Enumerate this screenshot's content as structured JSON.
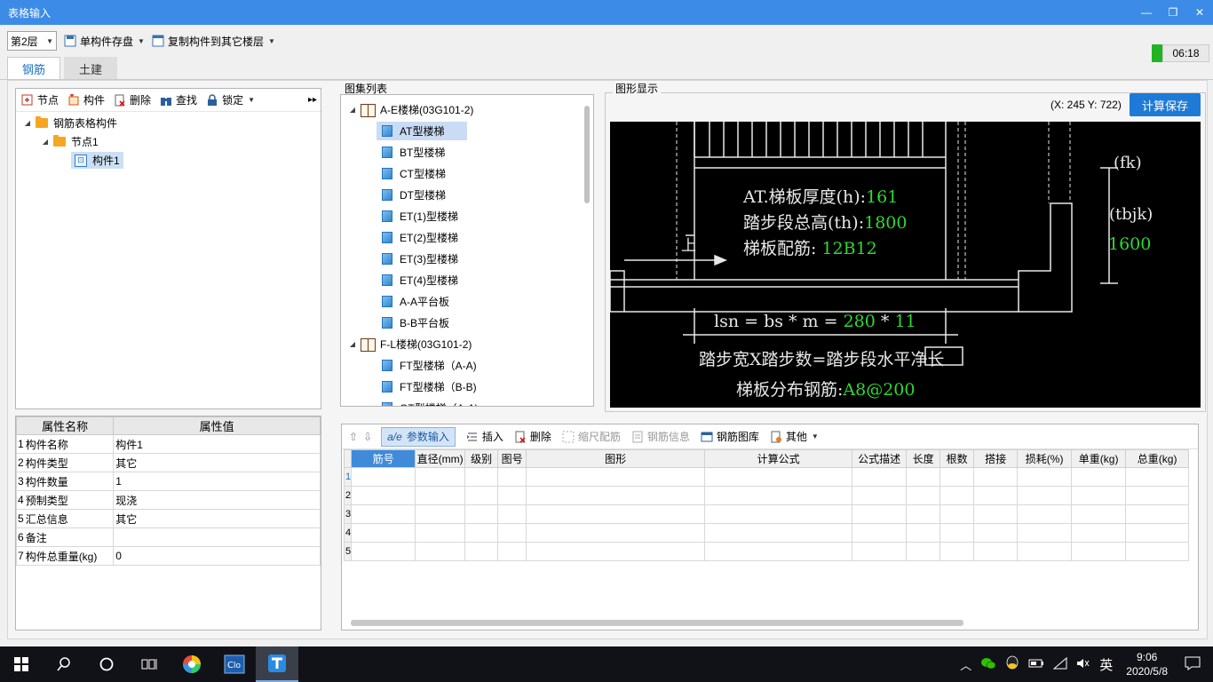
{
  "window": {
    "title": "表格输入",
    "min": "—",
    "restore": "❐",
    "close": "✕"
  },
  "toolbar": {
    "floor": "第2层",
    "save_single": "单构件存盘",
    "copy_to_floor": "复制构件到其它楼层"
  },
  "timer": "06:18",
  "tabs": [
    {
      "label": "钢筋"
    },
    {
      "label": "土建"
    }
  ],
  "left_toolbar": {
    "node": "节点",
    "component": "构件",
    "delete": "删除",
    "find": "查找",
    "lock": "锁定"
  },
  "tree": {
    "root": "钢筋表格构件",
    "node": "节点1",
    "component": "构件1"
  },
  "properties": {
    "header_name": "属性名称",
    "header_value": "属性值",
    "rows": [
      {
        "idx": "1",
        "name": "构件名称",
        "value": "构件1"
      },
      {
        "idx": "2",
        "name": "构件类型",
        "value": "其它"
      },
      {
        "idx": "3",
        "name": "构件数量",
        "value": "1"
      },
      {
        "idx": "4",
        "name": "预制类型",
        "value": "现浇"
      },
      {
        "idx": "5",
        "name": "汇总信息",
        "value": "其它"
      },
      {
        "idx": "6",
        "name": "备注",
        "value": ""
      },
      {
        "idx": "7",
        "name": "构件总重量(kg)",
        "value": "0"
      }
    ]
  },
  "atlas": {
    "title": "图集列表",
    "group1": "A-E楼梯(03G101-2)",
    "group1_items": [
      "AT型楼梯",
      "BT型楼梯",
      "CT型楼梯",
      "DT型楼梯",
      "ET(1)型楼梯",
      "ET(2)型楼梯",
      "ET(3)型楼梯",
      "ET(4)型楼梯",
      "A-A平台板",
      "B-B平台板"
    ],
    "group2": "F-L楼梯(03G101-2)",
    "group2_items": [
      "FT型楼梯（A-A)",
      "FT型楼梯（B-B)",
      "GT型楼梯（A-A)"
    ]
  },
  "graphic": {
    "title": "图形显示",
    "coords": "(X: 245 Y: 722)",
    "calc_save": "计算保存",
    "line1_label": "AT.梯板厚度(h):",
    "line1_value": "161",
    "line2_label": "踏步段总高(th):",
    "line2_value": "1800",
    "line3_label": "梯板配筋: ",
    "line3_value": "12B12",
    "fk": "(fk)",
    "tbjk": "(tbjk)",
    "tbjk_value": "1600",
    "lsn_formula": "lsn = bs * m =",
    "bs_value": "280",
    "star": "*",
    "m_value": "11",
    "desc": "踏步宽X踏步数=踏步段水平净长",
    "dist_label": "梯板分布钢筋:",
    "dist_value": "A8@200",
    "up_mark": "上"
  },
  "bottom_toolbar": {
    "param_input": "参数输入",
    "insert": "插入",
    "delete": "删除",
    "scale_rebar": "缩尺配筋",
    "rebar_info": "钢筋信息",
    "rebar_lib": "钢筋图库",
    "other": "其他"
  },
  "grid": {
    "headers": [
      "筋号",
      "直径(mm)",
      "级别",
      "图号",
      "图形",
      "计算公式",
      "公式描述",
      "长度",
      "根数",
      "搭接",
      "损耗(%)",
      "单重(kg)",
      "总重(kg)"
    ],
    "rows": [
      "1",
      "2",
      "3",
      "4",
      "5"
    ]
  },
  "taskbar": {
    "ime": "英",
    "time": "9:06",
    "date": "2020/5/8"
  }
}
